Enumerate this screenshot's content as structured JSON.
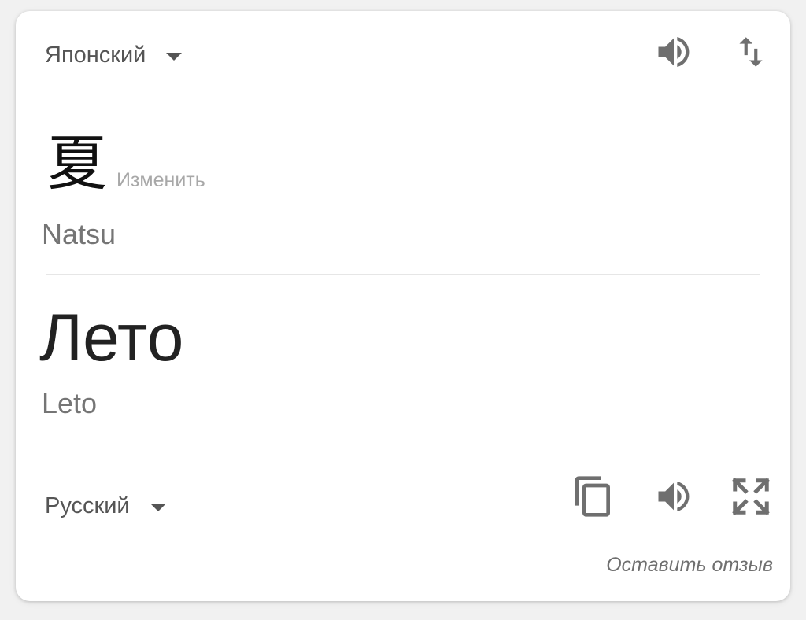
{
  "source": {
    "language": "Японский",
    "text": "夏",
    "edit_label": "Изменить",
    "transliteration": "Natsu",
    "speaker_icon": "volume-icon"
  },
  "swap_icon": "swap-languages-icon",
  "target": {
    "language": "Русский",
    "text": "Лето",
    "transliteration": "Leto",
    "copy_icon": "copy-icon",
    "speaker_icon": "volume-icon",
    "expand_icon": "fullscreen-icon"
  },
  "feedback_label": "Оставить отзыв",
  "colors": {
    "icon": "#6f6f6f",
    "text_primary": "#222222",
    "text_secondary": "#757575",
    "muted": "#a8a8a8"
  }
}
